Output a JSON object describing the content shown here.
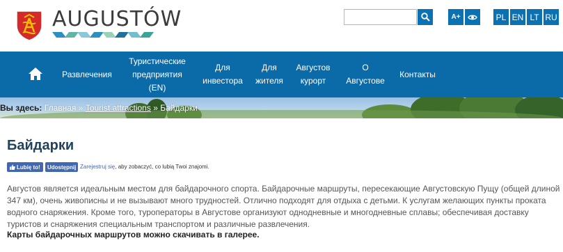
{
  "header": {
    "logo_text": "AUGUSTÓW",
    "search": {
      "value": "",
      "placeholder": ""
    },
    "tools": {
      "font_size_label": "A+"
    },
    "languages": [
      "PL",
      "EN",
      "LT",
      "RU"
    ]
  },
  "nav": {
    "items": [
      {
        "label": "Развлечения"
      },
      {
        "label": "Туристические предприятия (EN)"
      },
      {
        "label": "Для инвестора"
      },
      {
        "label": "Для жителя"
      },
      {
        "label": "Августов курорт"
      },
      {
        "label": "О Августове"
      },
      {
        "label": "Контакты"
      }
    ]
  },
  "breadcrumb": {
    "label": "Вы здесь:",
    "items": [
      "Главная",
      "Tourist attractions",
      "Байдарки"
    ],
    "separator": "»"
  },
  "main": {
    "title": "Байдарки",
    "facebook": {
      "like": "Lubię to!",
      "share": "Udostępnij",
      "signup": "Zarejestruj się",
      "signup_rest": ", aby zobaczyć, co lubią Twoi znajomi."
    },
    "paragraph": "Августов является идеальным местом для байдарочного спорта. Байдарочные маршруты, пересекающие Августовскую Пущу (общей длиной 347 км), очень живописны и не вызывают много трудностей. Отлично подходят для отдыха с детьми. К услугам желающих пункты проката водного снаряжения. Кроме того, туроператоры в Августове организуют однодневные и многодневные сплавы; обеспечивая доставку туристов и снаряжения специальным транспортом и различные развлечения.",
    "bold_note": "Карты байдарочных маршрутов можно скачивать в галерее."
  },
  "colors": {
    "primary_blue": "#0b6aa8",
    "button_blue": "#0a72b3",
    "title_color": "#20425f",
    "facebook_blue": "#4267b2"
  },
  "icons": [
    "city-crest-icon",
    "search-icon",
    "eye-icon",
    "home-icon",
    "thumbs-up-icon"
  ]
}
